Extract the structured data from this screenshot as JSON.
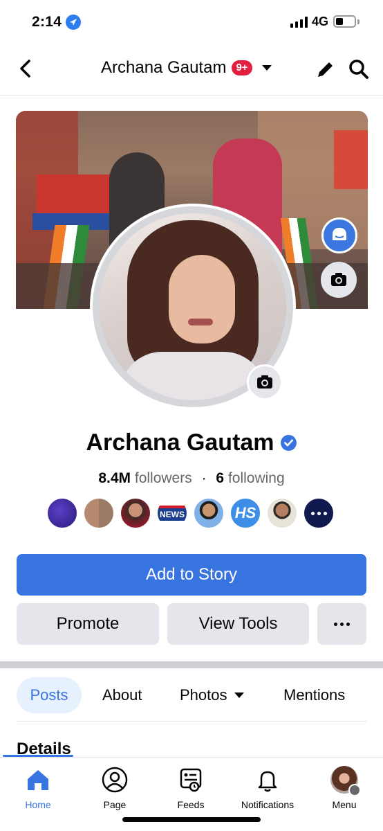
{
  "status_bar": {
    "time": "2:14",
    "network": "4G"
  },
  "header": {
    "title": "Archana Gautam",
    "badge": "9+"
  },
  "profile": {
    "name": "Archana Gautam",
    "followers_count": "8.4M",
    "followers_label": "followers",
    "separator": "·",
    "following_count": "6",
    "following_label": "following"
  },
  "actions": {
    "add_story": "Add to Story",
    "promote": "Promote",
    "view_tools": "View Tools"
  },
  "tabs": {
    "posts": "Posts",
    "about": "About",
    "photos": "Photos",
    "mentions": "Mentions"
  },
  "section": {
    "details": "Details"
  },
  "bottom_nav": {
    "home": "Home",
    "page": "Page",
    "feeds": "Feeds",
    "notifications": "Notifications",
    "menu": "Menu"
  },
  "follower_avatar_labels": {
    "news": "NEWS",
    "hs": "HS"
  },
  "colors": {
    "accent": "#3874e0",
    "badge": "#e41e3f",
    "button_grey": "#e4e6eb",
    "text_secondary": "#65676b"
  }
}
